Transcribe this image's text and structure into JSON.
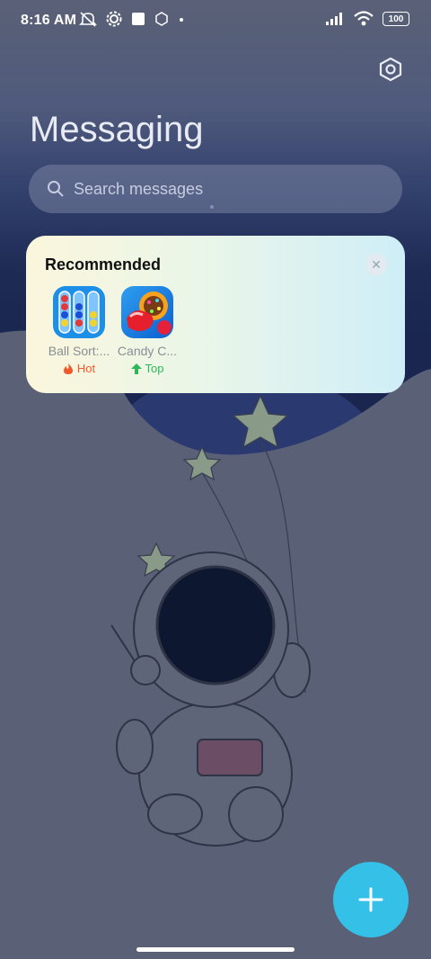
{
  "status_bar": {
    "time": "8:16 AM",
    "battery": "100",
    "icons_left": [
      "mute-icon",
      "gear-icon",
      "square-icon",
      "badge-icon",
      "dot-icon"
    ],
    "icons_right": [
      "signal-icon",
      "wifi-icon",
      "battery-icon"
    ]
  },
  "header": {
    "title": "Messaging",
    "settings_icon": "settings-hex-icon"
  },
  "search": {
    "placeholder": "Search messages",
    "icon": "search-icon"
  },
  "recommended": {
    "heading": "Recommended",
    "close_icon": "close-icon",
    "apps": [
      {
        "name": "Ball Sort:...",
        "tag": "Hot",
        "tag_icon": "flame-icon",
        "tag_color": "#f0592b"
      },
      {
        "name": "Candy C...",
        "tag": "Top",
        "tag_icon": "arrow-up-icon",
        "tag_color": "#2bb85a"
      }
    ]
  },
  "fab": {
    "icon": "plus-icon",
    "color": "#35c0e8"
  }
}
